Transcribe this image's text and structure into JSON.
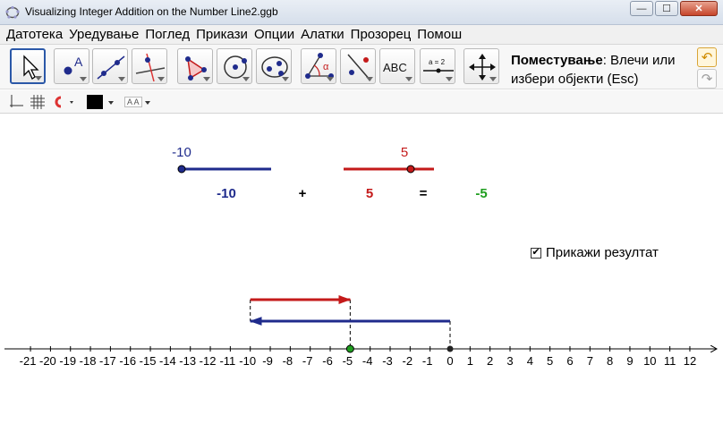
{
  "window": {
    "title": "Visualizing Integer Addition on the Number Line2.ggb",
    "buttons": {
      "minimize": "—",
      "maximize": "☐",
      "close": "✕"
    }
  },
  "menu": [
    "Датотека",
    "Уредување",
    "Поглед",
    "Прикази",
    "Опции",
    "Алатки",
    "Прозорец",
    "Помош"
  ],
  "toolbar": {
    "tools": [
      {
        "name": "move-tool",
        "icon": "arrow-cursor-icon",
        "active": true
      },
      {
        "name": "point-tool",
        "icon": "point-icon",
        "label": "A"
      },
      {
        "name": "line-tool",
        "icon": "line-icon"
      },
      {
        "name": "perpendicular-tool",
        "icon": "perpendicular-line-icon"
      },
      {
        "name": "polygon-tool",
        "icon": "polygon-icon"
      },
      {
        "name": "circle-tool",
        "icon": "circle-icon"
      },
      {
        "name": "conic-tool",
        "icon": "ellipse-icon"
      },
      {
        "name": "angle-tool",
        "icon": "angle-icon",
        "label": "α"
      },
      {
        "name": "reflect-tool",
        "icon": "reflect-icon"
      },
      {
        "name": "text-tool",
        "icon": "text-icon",
        "label": "ABC"
      },
      {
        "name": "slider-tool",
        "icon": "slider-icon",
        "label": "a = 2"
      },
      {
        "name": "move-view-tool",
        "icon": "move-view-icon"
      }
    ],
    "help_title": "Поместување",
    "help_text": ": Влечи или избери објекти (Esc)"
  },
  "stylebar": {
    "font_label": "A A"
  },
  "graphics": {
    "top": {
      "label_a": "-10",
      "label_b": "5",
      "expr_a": "-10",
      "expr_plus": "+",
      "expr_b": "5",
      "expr_eq": "=",
      "expr_result": "-5"
    },
    "checkbox": {
      "label": "Прикажи резултат",
      "checked": true
    },
    "number_line": {
      "ticks": [
        -21,
        -20,
        -19,
        -18,
        -17,
        -16,
        -15,
        -14,
        -13,
        -12,
        -11,
        -10,
        -9,
        -8,
        -7,
        -6,
        -5,
        -4,
        -3,
        -2,
        -1,
        0,
        1,
        2,
        3,
        4,
        5,
        6,
        7,
        8,
        9,
        10,
        11,
        12
      ],
      "first_addend": -10,
      "second_addend": 5,
      "result": -5
    }
  },
  "colors": {
    "blue": "#1f2b8c",
    "red": "#c41a1a",
    "green": "#1f9e1f",
    "accent": "#2b58a8"
  }
}
